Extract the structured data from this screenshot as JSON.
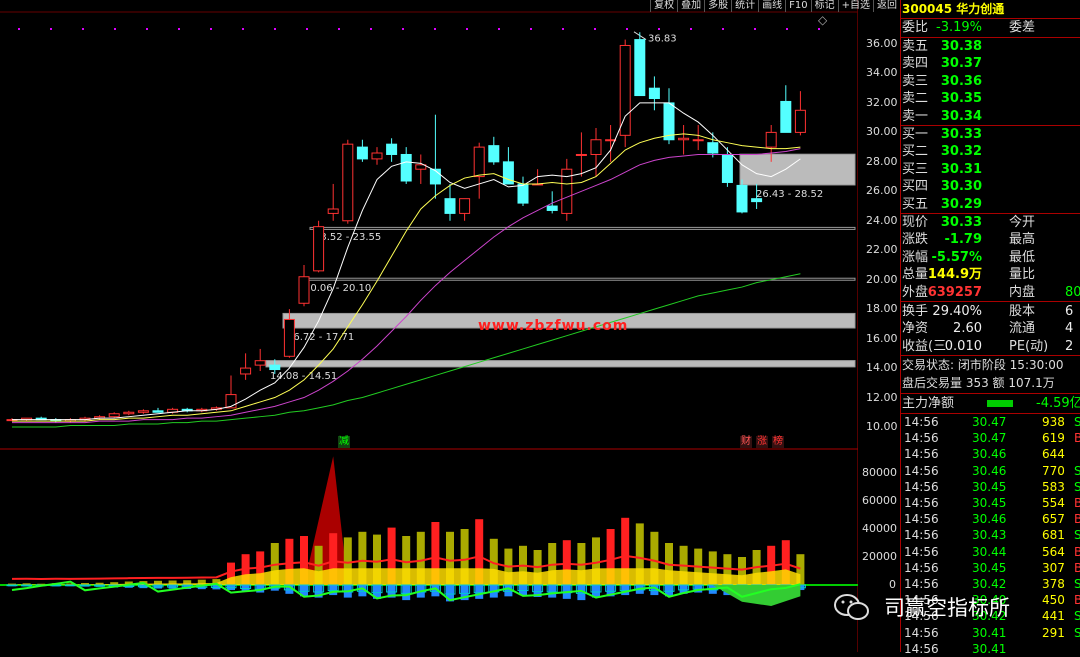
{
  "toolbar": [
    "复权",
    "叠加",
    "多股",
    "统计",
    "画线",
    "F10",
    "标记",
    "+自选",
    "返回"
  ],
  "stock": {
    "code": "300045",
    "name": "华力创通"
  },
  "quote": {
    "weibi_label": "委比",
    "weibi_value": "-3.19%",
    "weicha_label": "委差",
    "asks": [
      {
        "label": "卖五",
        "price": "30.38"
      },
      {
        "label": "卖四",
        "price": "30.37"
      },
      {
        "label": "卖三",
        "price": "30.36"
      },
      {
        "label": "卖二",
        "price": "30.35"
      },
      {
        "label": "卖一",
        "price": "30.34"
      }
    ],
    "bids": [
      {
        "label": "买一",
        "price": "30.33"
      },
      {
        "label": "买二",
        "price": "30.32"
      },
      {
        "label": "买三",
        "price": "30.31"
      },
      {
        "label": "买四",
        "price": "30.30"
      },
      {
        "label": "买五",
        "price": "30.29"
      }
    ],
    "stats": [
      {
        "l1": "现价",
        "v1": "30.33",
        "l2": "今开",
        "c": "#0f0"
      },
      {
        "l1": "涨跌",
        "v1": "-1.79",
        "l2": "最高",
        "c": "#0f0"
      },
      {
        "l1": "涨幅",
        "v1": "-5.57%",
        "l2": "最低",
        "c": "#0f0"
      },
      {
        "l1": "总量",
        "v1": "144.9万",
        "l2": "量比",
        "c": "#ff0"
      },
      {
        "l1": "外盘",
        "v1": "639257",
        "l2": "内盘",
        "v2": "80",
        "c": "#f33"
      }
    ],
    "stats2": [
      {
        "l1": "换手",
        "v1": "29.40%",
        "l2": "股本",
        "v2": "6"
      },
      {
        "l1": "净资",
        "v1": "2.60",
        "l2": "流通",
        "v2": "4"
      },
      {
        "l1": "收益(三",
        "v1": "0.010",
        "l2": "PE(动)",
        "v2": "2"
      }
    ],
    "trade_status": "交易状态: 闭市阶段 15:30:00",
    "after_hours": "盘后交易量 353 额 107.1万",
    "main_net_label": "主力净额",
    "main_net_value": "-4.59亿"
  },
  "ticks": [
    {
      "t": "14:56",
      "p": "30.47",
      "v": "938",
      "d": "S"
    },
    {
      "t": "14:56",
      "p": "30.47",
      "v": "619",
      "d": "B"
    },
    {
      "t": "14:56",
      "p": "30.46",
      "v": "644",
      "d": ""
    },
    {
      "t": "14:56",
      "p": "30.46",
      "v": "770",
      "d": "S"
    },
    {
      "t": "14:56",
      "p": "30.45",
      "v": "583",
      "d": "S"
    },
    {
      "t": "14:56",
      "p": "30.45",
      "v": "554",
      "d": "B"
    },
    {
      "t": "14:56",
      "p": "30.46",
      "v": "657",
      "d": "B"
    },
    {
      "t": "14:56",
      "p": "30.43",
      "v": "681",
      "d": "S"
    },
    {
      "t": "14:56",
      "p": "30.44",
      "v": "564",
      "d": "B"
    },
    {
      "t": "14:56",
      "p": "30.45",
      "v": "307",
      "d": "B"
    },
    {
      "t": "14:56",
      "p": "30.42",
      "v": "378",
      "d": "S"
    },
    {
      "t": "14:56",
      "p": "30.40",
      "v": "450",
      "d": "B"
    },
    {
      "t": "14:56",
      "p": "30.42",
      "v": "441",
      "d": "S"
    },
    {
      "t": "14:56",
      "p": "30.41",
      "v": "291",
      "d": "S"
    },
    {
      "t": "14:56",
      "p": "30.41",
      "v": "",
      "d": ""
    }
  ],
  "chart_data": {
    "type": "candlestick",
    "price_axis": {
      "ticks": [
        "36.00",
        "34.00",
        "32.00",
        "30.00",
        "28.00",
        "26.00",
        "24.00",
        "22.00",
        "20.00",
        "18.00",
        "16.00",
        "14.00",
        "12.00",
        "10.00"
      ],
      "min": 10,
      "max": 36
    },
    "indicator_axis": {
      "ticks": [
        "80000",
        "60000",
        "40000",
        "20000",
        "0"
      ],
      "min": -10000,
      "max": 80000
    },
    "annotations": [
      "36.83",
      "26.43 - 28.52",
      "23.52 - 23.55",
      "20.06 - 20.10",
      "16.72 - 17.71",
      "14.08 - 14.51"
    ],
    "zones": [
      {
        "label": "26.43 - 28.52",
        "lo": 26.43,
        "hi": 28.52
      },
      {
        "label": "23.52 - 23.55",
        "lo": 23.52,
        "hi": 23.55
      },
      {
        "label": "20.06 - 20.10",
        "lo": 20.06,
        "hi": 20.1
      },
      {
        "label": "16.72 - 17.71",
        "lo": 16.72,
        "hi": 17.71
      },
      {
        "label": "14.08 - 14.51",
        "lo": 14.08,
        "hi": 14.51
      }
    ],
    "candles": [
      [
        10.5,
        10.6,
        10.4,
        10.5
      ],
      [
        10.5,
        10.6,
        10.4,
        10.6
      ],
      [
        10.6,
        10.7,
        10.5,
        10.5
      ],
      [
        10.5,
        10.6,
        10.3,
        10.4
      ],
      [
        10.4,
        10.6,
        10.3,
        10.5
      ],
      [
        10.5,
        10.7,
        10.4,
        10.6
      ],
      [
        10.6,
        10.8,
        10.5,
        10.7
      ],
      [
        10.7,
        11.0,
        10.6,
        10.9
      ],
      [
        10.9,
        11.1,
        10.8,
        11.0
      ],
      [
        11.0,
        11.2,
        10.9,
        11.1
      ],
      [
        11.1,
        11.3,
        11.0,
        11.0
      ],
      [
        11.0,
        11.3,
        10.9,
        11.2
      ],
      [
        11.2,
        11.3,
        11.0,
        11.1
      ],
      [
        11.1,
        11.3,
        11.0,
        11.2
      ],
      [
        11.2,
        11.4,
        11.1,
        11.3
      ],
      [
        11.3,
        13.5,
        11.3,
        12.2
      ],
      [
        13.6,
        15.0,
        13.2,
        14.0
      ],
      [
        14.2,
        15.3,
        13.8,
        14.5
      ],
      [
        14.2,
        14.6,
        13.6,
        13.9
      ],
      [
        14.8,
        18.0,
        14.7,
        17.3
      ],
      [
        18.4,
        21.0,
        18.2,
        20.2
      ],
      [
        20.6,
        24.0,
        20.5,
        23.6
      ],
      [
        24.5,
        26.5,
        24.0,
        24.8
      ],
      [
        24.0,
        29.5,
        23.8,
        29.2
      ],
      [
        29.0,
        29.5,
        28.0,
        28.2
      ],
      [
        28.2,
        29.0,
        27.8,
        28.6
      ],
      [
        29.2,
        29.6,
        28.0,
        28.5
      ],
      [
        28.5,
        29.0,
        26.5,
        26.7
      ],
      [
        27.5,
        28.5,
        26.5,
        27.8
      ],
      [
        27.5,
        31.2,
        25.5,
        26.5
      ],
      [
        25.5,
        26.5,
        24.0,
        24.5
      ],
      [
        24.5,
        25.5,
        24.0,
        25.5
      ],
      [
        27.0,
        29.3,
        25.5,
        29.0
      ],
      [
        29.1,
        29.7,
        27.8,
        28.0
      ],
      [
        28.0,
        29.0,
        26.5,
        26.5
      ],
      [
        26.5,
        27.0,
        25.0,
        25.2
      ],
      [
        26.5,
        27.5,
        26.5,
        26.5
      ],
      [
        25.0,
        26.0,
        24.5,
        24.7
      ],
      [
        24.5,
        28.2,
        24.0,
        27.5
      ],
      [
        28.5,
        30.0,
        27.0,
        28.5
      ],
      [
        28.5,
        30.3,
        27.0,
        29.5
      ],
      [
        29.5,
        30.5,
        28.0,
        29.5
      ],
      [
        29.8,
        36.3,
        29.0,
        35.9
      ],
      [
        36.3,
        36.8,
        32.5,
        32.5
      ],
      [
        33.0,
        33.8,
        31.5,
        32.3
      ],
      [
        32.0,
        33.0,
        29.2,
        29.5
      ],
      [
        29.5,
        30.5,
        28.5,
        29.6
      ],
      [
        29.5,
        30.5,
        28.8,
        29.5
      ],
      [
        29.3,
        30.0,
        28.3,
        28.6
      ],
      [
        28.5,
        29.0,
        26.3,
        26.6
      ],
      [
        26.4,
        26.8,
        24.5,
        24.6
      ],
      [
        25.5,
        26.5,
        24.8,
        25.3
      ],
      [
        29.0,
        30.5,
        28.0,
        30.0
      ],
      [
        32.1,
        33.2,
        30.0,
        30.0
      ],
      [
        30.0,
        32.8,
        29.8,
        31.5
      ]
    ],
    "mas": [
      {
        "name": "MA5",
        "color": "#ffffff",
        "values": [
          10.5,
          10.5,
          10.5,
          10.5,
          10.5,
          10.5,
          10.6,
          10.6,
          10.7,
          10.8,
          10.9,
          11.0,
          11.1,
          11.1,
          11.2,
          11.4,
          11.9,
          12.5,
          13.0,
          14.0,
          15.4,
          17.2,
          19.4,
          22.2,
          24.7,
          26.8,
          27.7,
          28.0,
          27.9,
          27.4,
          26.6,
          26.2,
          26.5,
          26.8,
          26.3,
          26.4,
          27.0,
          27.1,
          27.0,
          27.2,
          27.6,
          28.8,
          31.1,
          32.0,
          32.0,
          32.0,
          31.3,
          30.7,
          29.8,
          28.8,
          27.8,
          27.2,
          27.0,
          27.5,
          28.2
        ]
      },
      {
        "name": "MA10",
        "color": "#ffff55",
        "values": [
          10.4,
          10.4,
          10.4,
          10.4,
          10.4,
          10.4,
          10.5,
          10.5,
          10.6,
          10.6,
          10.7,
          10.8,
          10.8,
          10.9,
          11.0,
          11.1,
          11.4,
          11.7,
          12.0,
          12.5,
          13.2,
          14.2,
          15.3,
          16.8,
          18.3,
          19.9,
          21.6,
          23.3,
          24.8,
          25.7,
          26.4,
          26.9,
          27.1,
          27.2,
          26.8,
          26.5,
          26.5,
          26.6,
          26.5,
          26.6,
          27.0,
          27.9,
          28.8,
          29.3,
          29.6,
          29.8,
          29.9,
          29.8,
          29.5,
          29.3,
          29.1,
          29.0,
          28.9,
          28.9,
          29.0
        ]
      },
      {
        "name": "MA20",
        "color": "#cc44cc",
        "values": [
          10.3,
          10.3,
          10.3,
          10.3,
          10.3,
          10.3,
          10.4,
          10.4,
          10.4,
          10.5,
          10.5,
          10.5,
          10.6,
          10.6,
          10.7,
          10.8,
          11.0,
          11.2,
          11.4,
          11.7,
          12.0,
          12.5,
          13.1,
          13.8,
          14.6,
          15.5,
          16.5,
          17.5,
          18.6,
          19.6,
          20.5,
          21.3,
          22.1,
          22.9,
          23.6,
          24.2,
          24.7,
          25.2,
          25.6,
          26.0,
          26.4,
          26.8,
          27.3,
          27.8,
          28.1,
          28.3,
          28.4,
          28.5,
          28.5,
          28.5,
          28.5,
          28.5,
          28.6,
          28.7,
          28.9
        ]
      },
      {
        "name": "MA60",
        "color": "#22cc22",
        "values": [
          10.0,
          10.0,
          10.0,
          10.0,
          10.1,
          10.1,
          10.1,
          10.1,
          10.2,
          10.2,
          10.2,
          10.3,
          10.3,
          10.4,
          10.4,
          10.5,
          10.6,
          10.7,
          10.8,
          11.0,
          11.1,
          11.3,
          11.5,
          11.8,
          12.0,
          12.3,
          12.6,
          12.9,
          13.2,
          13.5,
          13.8,
          14.1,
          14.4,
          14.7,
          15.0,
          15.3,
          15.6,
          15.9,
          16.2,
          16.5,
          16.8,
          17.1,
          17.4,
          17.7,
          18.0,
          18.3,
          18.6,
          18.9,
          19.1,
          19.3,
          19.5,
          19.8,
          20.0,
          20.2,
          20.4
        ]
      }
    ],
    "volume_bars": [
      1000,
      1200,
      900,
      1300,
      1100,
      1400,
      1600,
      2000,
      2500,
      2800,
      3000,
      3200,
      3400,
      3800,
      4200,
      16000,
      22000,
      24000,
      30000,
      33000,
      35000,
      28000,
      37000,
      34000,
      38000,
      36000,
      41000,
      35000,
      38000,
      45000,
      38000,
      40000,
      47000,
      33000,
      26000,
      28000,
      25000,
      30000,
      32000,
      30000,
      34000,
      40000,
      48000,
      44000,
      38000,
      30000,
      28000,
      26000,
      24000,
      22000,
      20000,
      25000,
      28000,
      32000,
      22000
    ],
    "volume_colors": [
      "y",
      "y",
      "y",
      "y",
      "y",
      "y",
      "y",
      "y",
      "y",
      "y",
      "y",
      "y",
      "y",
      "y",
      "y",
      "r",
      "r",
      "r",
      "y",
      "r",
      "r",
      "y",
      "r",
      "y",
      "y",
      "y",
      "r",
      "y",
      "y",
      "r",
      "y",
      "y",
      "r",
      "y",
      "y",
      "y",
      "y",
      "y",
      "r",
      "y",
      "y",
      "r",
      "r",
      "y",
      "y",
      "y",
      "y",
      "y",
      "y",
      "y",
      "y",
      "y",
      "r",
      "r",
      "y"
    ],
    "neg_bars": [
      -1000,
      -1200,
      -900,
      -1100,
      -1000,
      -1300,
      -1500,
      -2000,
      -2200,
      -2500,
      -2800,
      -3000,
      -3200,
      -3300,
      -3500,
      -4000,
      -5000,
      -6000,
      -4500,
      -7000,
      -9000,
      -10000,
      -8000,
      -10000,
      -9000,
      -11000,
      -10000,
      -12000,
      -10000,
      -9000,
      -13000,
      -12000,
      -11000,
      -10000,
      -9000,
      -8000,
      -9500,
      -10000,
      -11000,
      -12000,
      -10000,
      -9000,
      -8000,
      -7000,
      -8000,
      -9000,
      -7000,
      -6000,
      -7000,
      -8000,
      -9000,
      -7000,
      -5000,
      -6000,
      -4000
    ],
    "center_label": "减",
    "markers": [
      {
        "text": "财",
        "color": "#ff5555"
      },
      {
        "text": "涨",
        "color": "#ff3333"
      },
      {
        "text": "榜",
        "color": "#ff3333"
      }
    ]
  },
  "watermark": "www.zbzfwu.com",
  "logo_text": "司赢空指标所"
}
